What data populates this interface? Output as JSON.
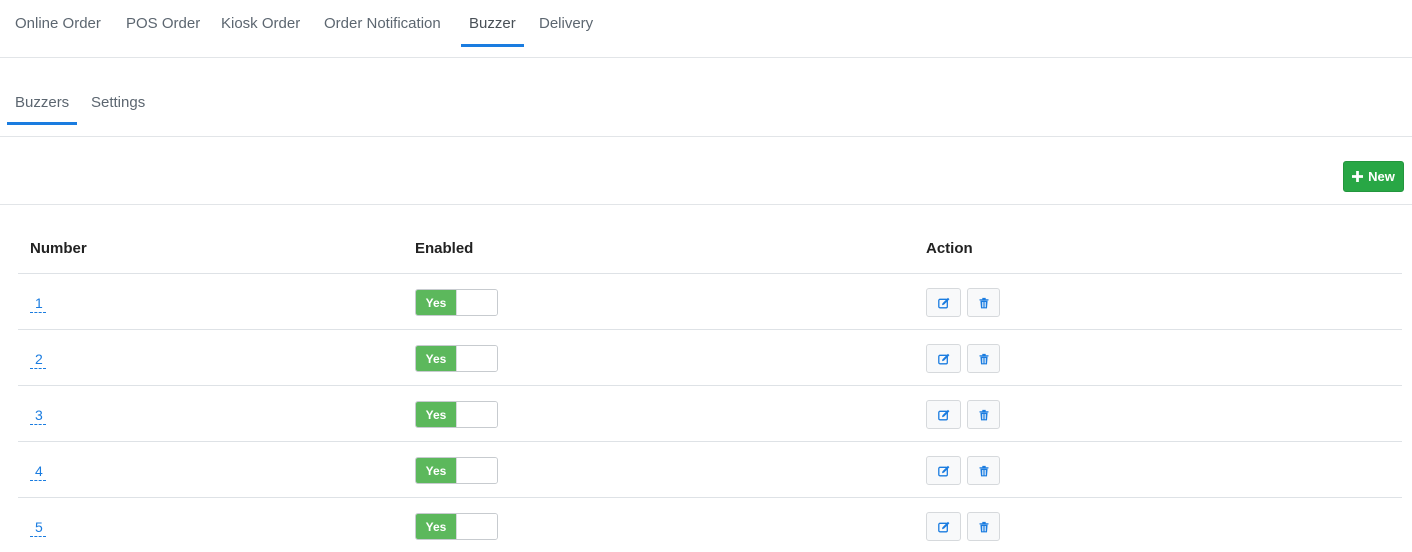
{
  "top_tabs": [
    {
      "label": "Online Order"
    },
    {
      "label": "POS Order"
    },
    {
      "label": "Kiosk Order"
    },
    {
      "label": "Order Notification"
    },
    {
      "label": "Buzzer",
      "active": true
    },
    {
      "label": "Delivery"
    }
  ],
  "sub_tabs": [
    {
      "label": "Buzzers",
      "active": true
    },
    {
      "label": "Settings"
    }
  ],
  "toolbar": {
    "new_label": "New",
    "new_icon": "plus-icon",
    "accent": "#28a745"
  },
  "table": {
    "headers": {
      "number": "Number",
      "enabled": "Enabled",
      "action": "Action"
    },
    "rows": [
      {
        "number": "1",
        "enabled": "Yes"
      },
      {
        "number": "2",
        "enabled": "Yes"
      },
      {
        "number": "3",
        "enabled": "Yes"
      },
      {
        "number": "4",
        "enabled": "Yes"
      },
      {
        "number": "5",
        "enabled": "Yes"
      }
    ],
    "action_icons": [
      "edit-icon",
      "trash-icon"
    ]
  },
  "colors": {
    "active_tab_underline": "#1a7ce0",
    "toggle_on": "#5cb85c",
    "link": "#1a7ce0"
  }
}
